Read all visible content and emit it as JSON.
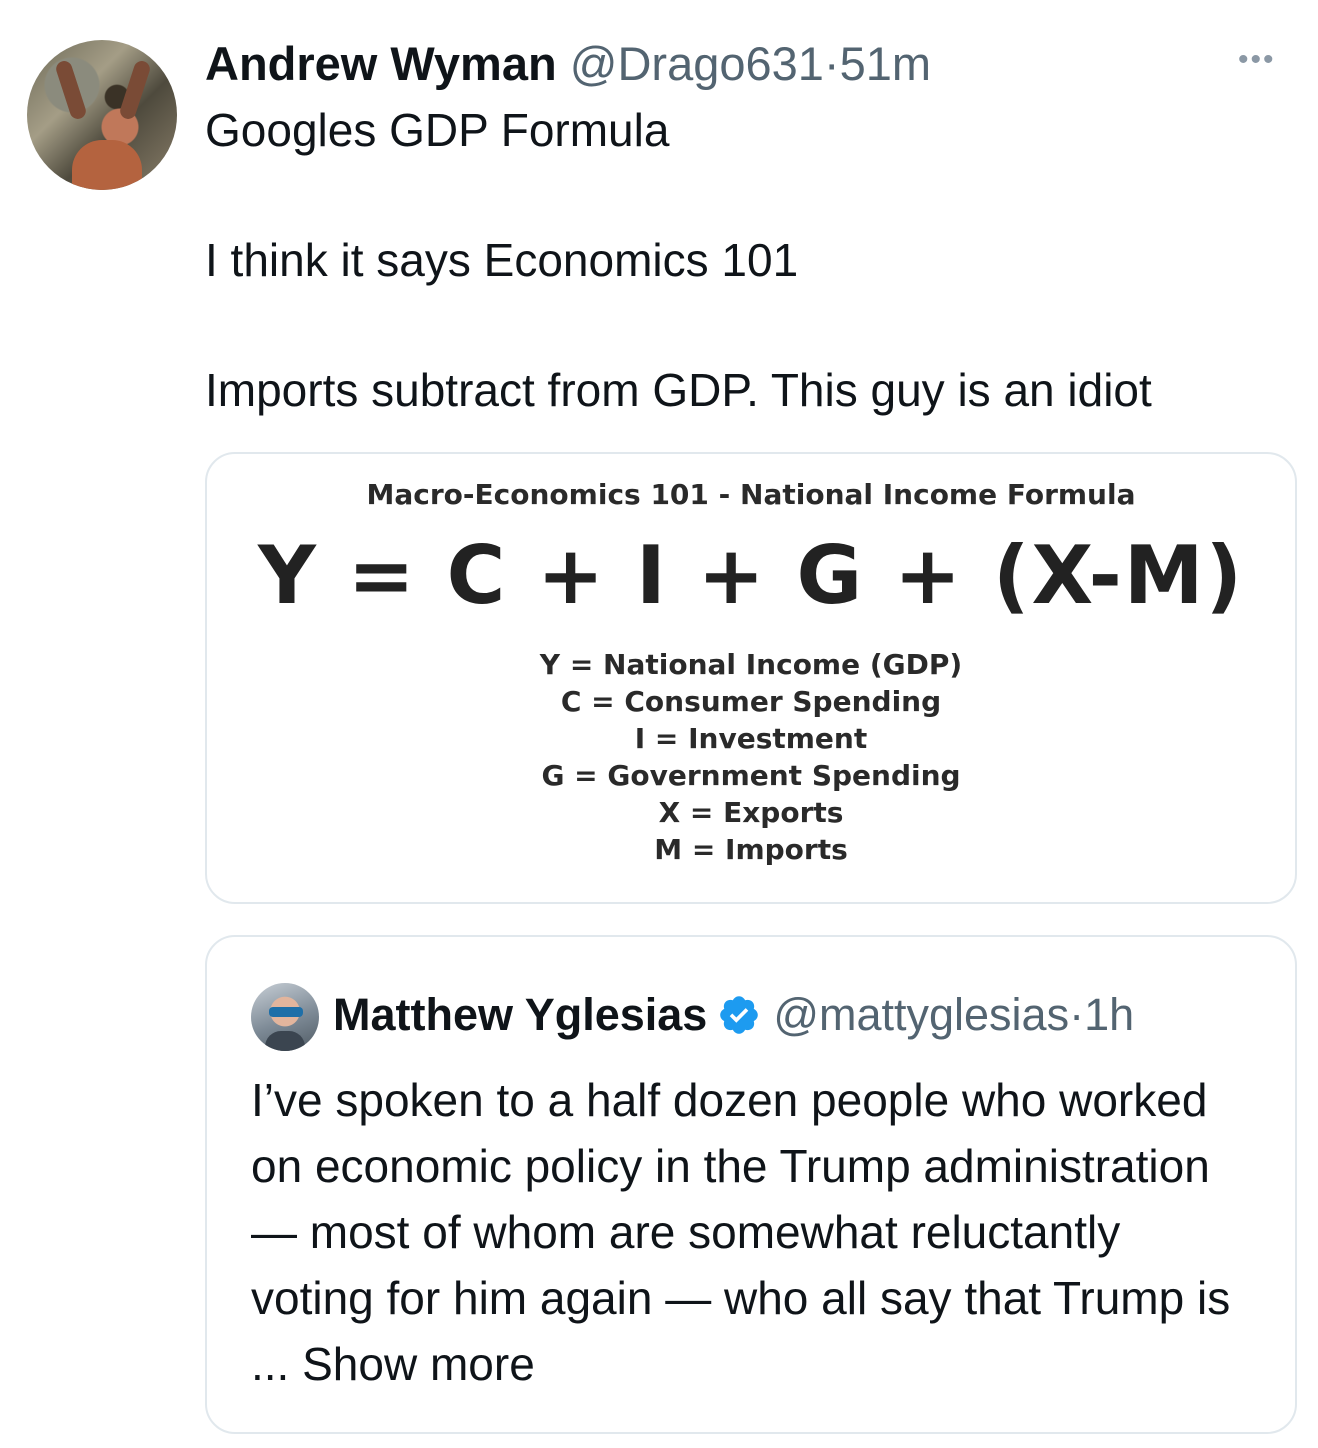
{
  "tweet": {
    "author_name": "Andrew Wyman",
    "handle": "@Drago631",
    "separator": "·",
    "time": "51m",
    "more_icon": "ellipsis-icon",
    "text_lines": [
      "Googles GDP Formula",
      "I think it says Economics 101",
      "Imports subtract from GDP. This guy is an idiot"
    ]
  },
  "media": {
    "title": "Macro-Economics 101 - National Income Formula",
    "formula": "Y = C + I + G + (X-M)",
    "definitions": [
      "Y = National Income (GDP)",
      "C = Consumer Spending",
      "I = Investment",
      "G = Government Spending",
      "X = Exports",
      "M = Imports"
    ]
  },
  "quote": {
    "author_name": "Matthew Yglesias",
    "verified_icon": "verified-badge-icon",
    "handle": "@mattyglesias",
    "separator": "·",
    "time": "1h",
    "text": "I’ve spoken to a half dozen people who worked on economic policy in the Trump administration — most of whom are somewhat reluctantly voting for him again — who all say that Trump is ...",
    "show_more": "Show more"
  },
  "colors": {
    "text": "#0f1419",
    "muted": "#536471",
    "border": "#e1e8ed",
    "verified": "#1d9bf0"
  }
}
